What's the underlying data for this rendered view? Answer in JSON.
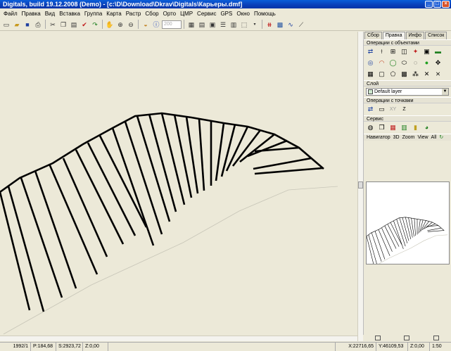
{
  "window": {
    "title": "Digitals, build 19.12.2008 (Demo) - [c:\\D\\Download\\Dkrav\\Digitals\\Карьеры.dmf]",
    "minimize": "_",
    "maximize": "□",
    "close": "×"
  },
  "menu": [
    "Файл",
    "Правка",
    "Вид",
    "Вставка",
    "Группа",
    "Карта",
    "Растр",
    "Сбор",
    "Орто",
    "ЦМР",
    "Сервис",
    "GPS",
    "Окно",
    "Помощь"
  ],
  "toolbar": {
    "zoom_value": "200",
    "icons": [
      "new-file-icon",
      "open-folder-icon",
      "save-icon",
      "print-icon",
      "cut-icon",
      "copy-icon",
      "paste-icon",
      "check-icon",
      "redo-icon",
      "pan-icon",
      "zoom-in-icon",
      "zoom-out-icon",
      "paint-icon",
      "info-icon"
    ]
  },
  "panel": {
    "tabs": [
      {
        "label": "Сбор",
        "active": false
      },
      {
        "label": "Правка",
        "active": true
      },
      {
        "label": "Инфо",
        "active": false
      },
      {
        "label": "Список",
        "active": false
      }
    ],
    "object_ops_label": "Операции с объектами",
    "layer_label": "Слой",
    "layer_value": "Default layer",
    "point_ops_label": "Операции с точками",
    "point_ops_text": [
      "XY",
      "Z"
    ],
    "service_label": "Сервис",
    "navigator_label": "Навигатор",
    "navigator_tabs": [
      "3D",
      "Zoom",
      "View",
      "All"
    ]
  },
  "status": {
    "id": "1992/1",
    "perimeter": "P:184,68",
    "area": "S:2923,72",
    "z": "Z:0,00",
    "x": "X:22716,65",
    "y": "Y:46109,53",
    "z2": "Z:0,00",
    "scale": "1:50"
  },
  "colors": {
    "title_bar": "#0a3fb8",
    "background": "#ece9d8",
    "stroke": "#000000",
    "boundary": "#c8c6b8"
  }
}
